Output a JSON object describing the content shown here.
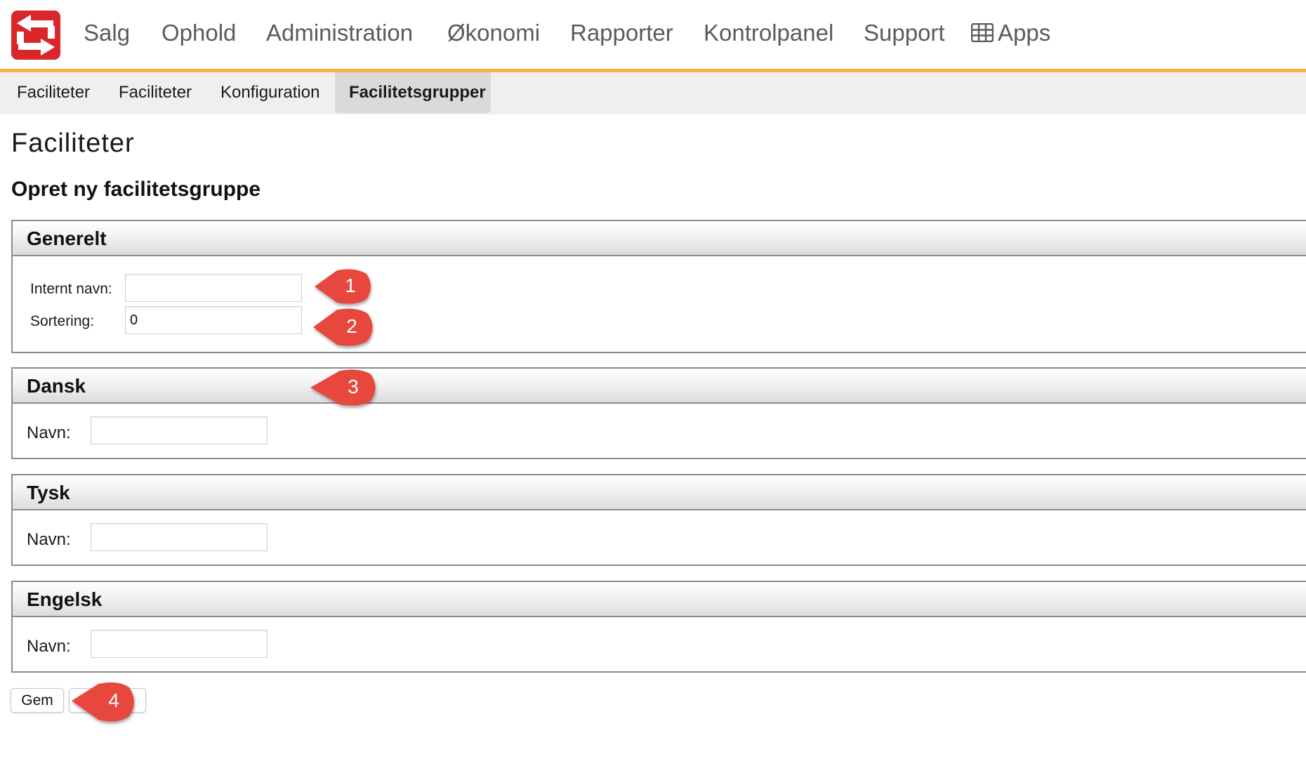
{
  "nav": {
    "items": [
      "Salg",
      "Ophold",
      "Administration",
      "Økonomi",
      "Rapporter",
      "Kontrolpanel",
      "Support"
    ],
    "apps_label": "Apps",
    "apps_icon": "grid-icon",
    "accent_color": "#f3b33d",
    "logo_color": "#d9262b"
  },
  "subnav": {
    "items": [
      "Faciliteter",
      "Faciliteter",
      "Konfiguration",
      "Facilitetsgrupper"
    ],
    "active": "Facilitetsgrupper"
  },
  "page": {
    "title": "Faciliteter",
    "subtitle": "Opret ny facilitetsgruppe"
  },
  "sections": {
    "general": {
      "title": "Generelt",
      "internal_name_label": "Internt navn:",
      "internal_name_value": "",
      "sort_label": "Sortering:",
      "sort_value": "0"
    },
    "danish": {
      "title": "Dansk",
      "name_label": "Navn:",
      "name_value": ""
    },
    "german": {
      "title": "Tysk",
      "name_label": "Navn:",
      "name_value": ""
    },
    "english": {
      "title": "Engelsk",
      "name_label": "Navn:",
      "name_value": ""
    }
  },
  "actions": {
    "save_label": "Gem"
  },
  "callouts": {
    "color": "#e8473e",
    "numbers": [
      "1",
      "2",
      "3",
      "4"
    ]
  }
}
